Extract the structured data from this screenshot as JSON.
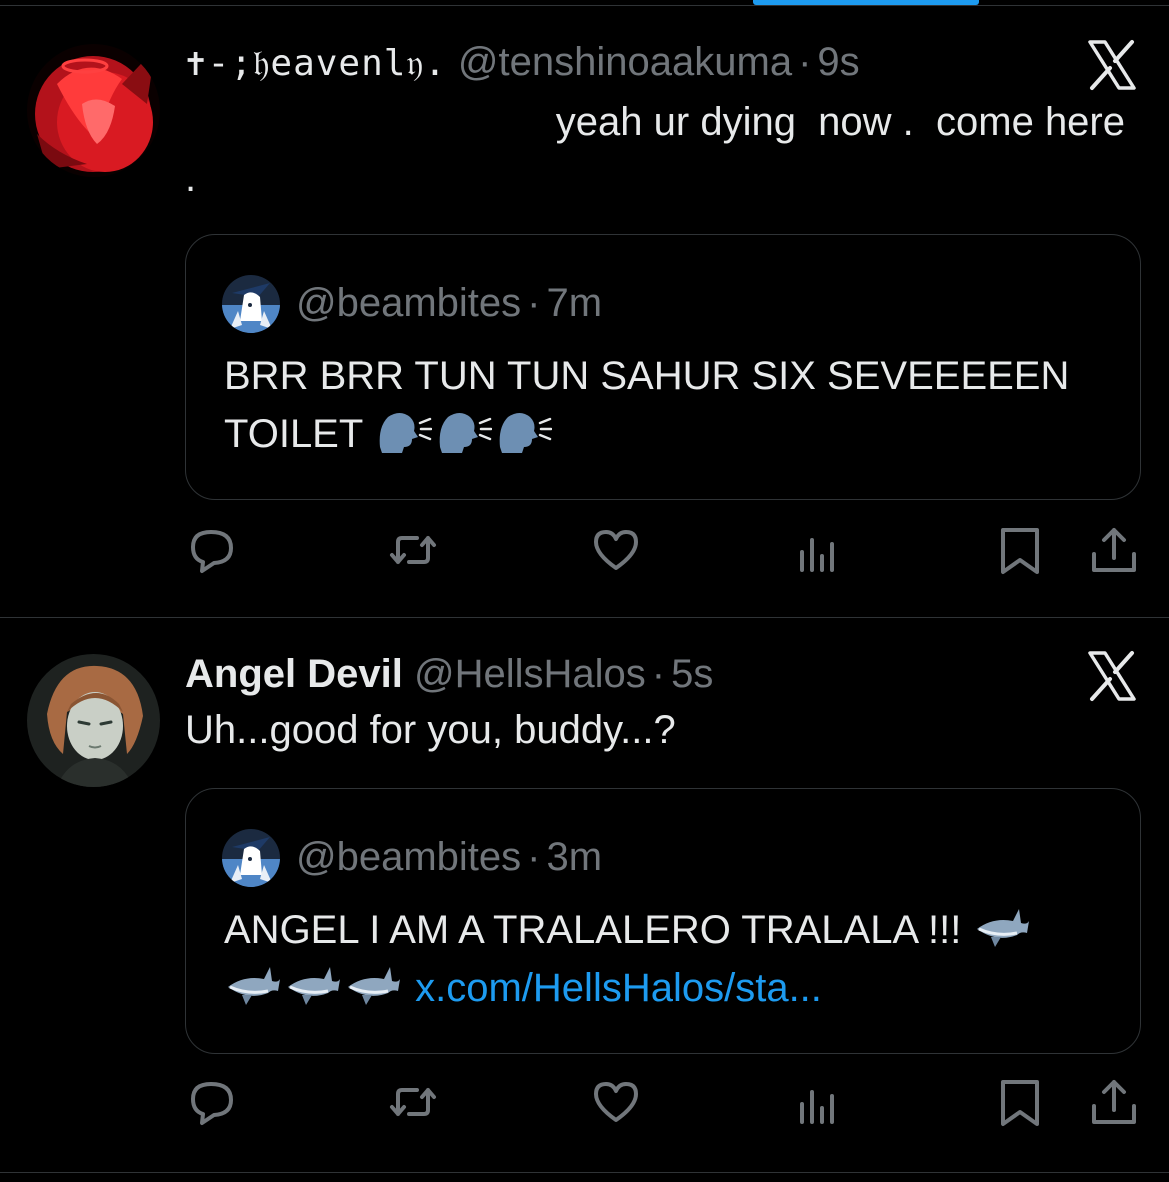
{
  "colors": {
    "background": "#000000",
    "text": "#e7e9ea",
    "muted": "#71767b",
    "accent": "#1d9bf0",
    "border": "#2f3336"
  },
  "tweets": [
    {
      "display_name": "✝︎-;𝔥eavenl𝔶.",
      "handle": "@tenshinoaakuma",
      "separator": "·",
      "time": "9s",
      "text": "yeah ur dying  now .  come here",
      "text_line2": ".",
      "avatar_icon": "red-angel-avatar",
      "x_icon": "x-logo-icon",
      "quote": {
        "handle": "@beambites",
        "separator": "·",
        "time": "7m",
        "text": "BRR BRR TUN TUN SAHUR SIX SEVEEEEEN TOILET",
        "emoji": [
          "speaking-head-emoji",
          "speaking-head-emoji",
          "speaking-head-emoji"
        ]
      }
    },
    {
      "display_name": "Angel Devil",
      "handle": "@HellsHalos",
      "separator": "·",
      "time": "5s",
      "text": "Uh...good for you, buddy...?",
      "avatar_icon": "angel-devil-avatar",
      "x_icon": "x-logo-icon",
      "quote": {
        "handle": "@beambites",
        "separator": "·",
        "time": "3m",
        "text": "ANGEL I AM A TRALALERO TRALALA !!!",
        "emoji": [
          "shark-emoji",
          "shark-emoji",
          "shark-emoji",
          "shark-emoji"
        ],
        "link": "x.com/HellsHalos/sta..."
      }
    }
  ],
  "actions": [
    "reply-icon",
    "retweet-icon",
    "like-icon",
    "views-icon",
    "bookmark-icon",
    "share-icon"
  ]
}
